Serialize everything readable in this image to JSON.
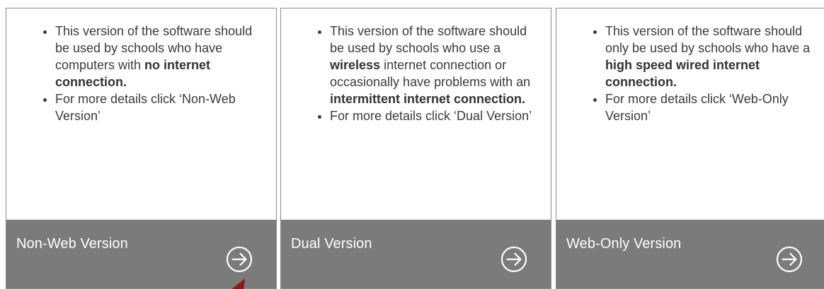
{
  "cards": [
    {
      "title": "Non-Web Version",
      "bullet1": {
        "pre": "This version of the software should be used by schools who have computers with ",
        "bold": "no internet connection.",
        "post": ""
      },
      "bullet2": "For more details click ‘Non-Web Version’"
    },
    {
      "title": "Dual Version",
      "bullet1": {
        "pre": "This version of the software should be used by schools who use a ",
        "bold": "wireless",
        "mid": " internet connection or occasionally have problems with an ",
        "bold2": "intermittent internet connection.",
        "post": ""
      },
      "bullet2": "For more details click ‘Dual Version’"
    },
    {
      "title": "Web-Only Version",
      "bullet1": {
        "pre": "This version of the software should only be used by schools who have a ",
        "bold": "high speed wired internet connection.",
        "post": ""
      },
      "bullet2": "For more details click ‘Web-Only Version’"
    }
  ],
  "colors": {
    "footer_bg": "#7b7b7b",
    "card_border": "#8a8a8a",
    "pointer_arrow": "#8b1a1a"
  },
  "icons": {
    "footer_arrow": "circle-arrow-right-icon",
    "pointer": "red-pointer-arrow-icon"
  }
}
